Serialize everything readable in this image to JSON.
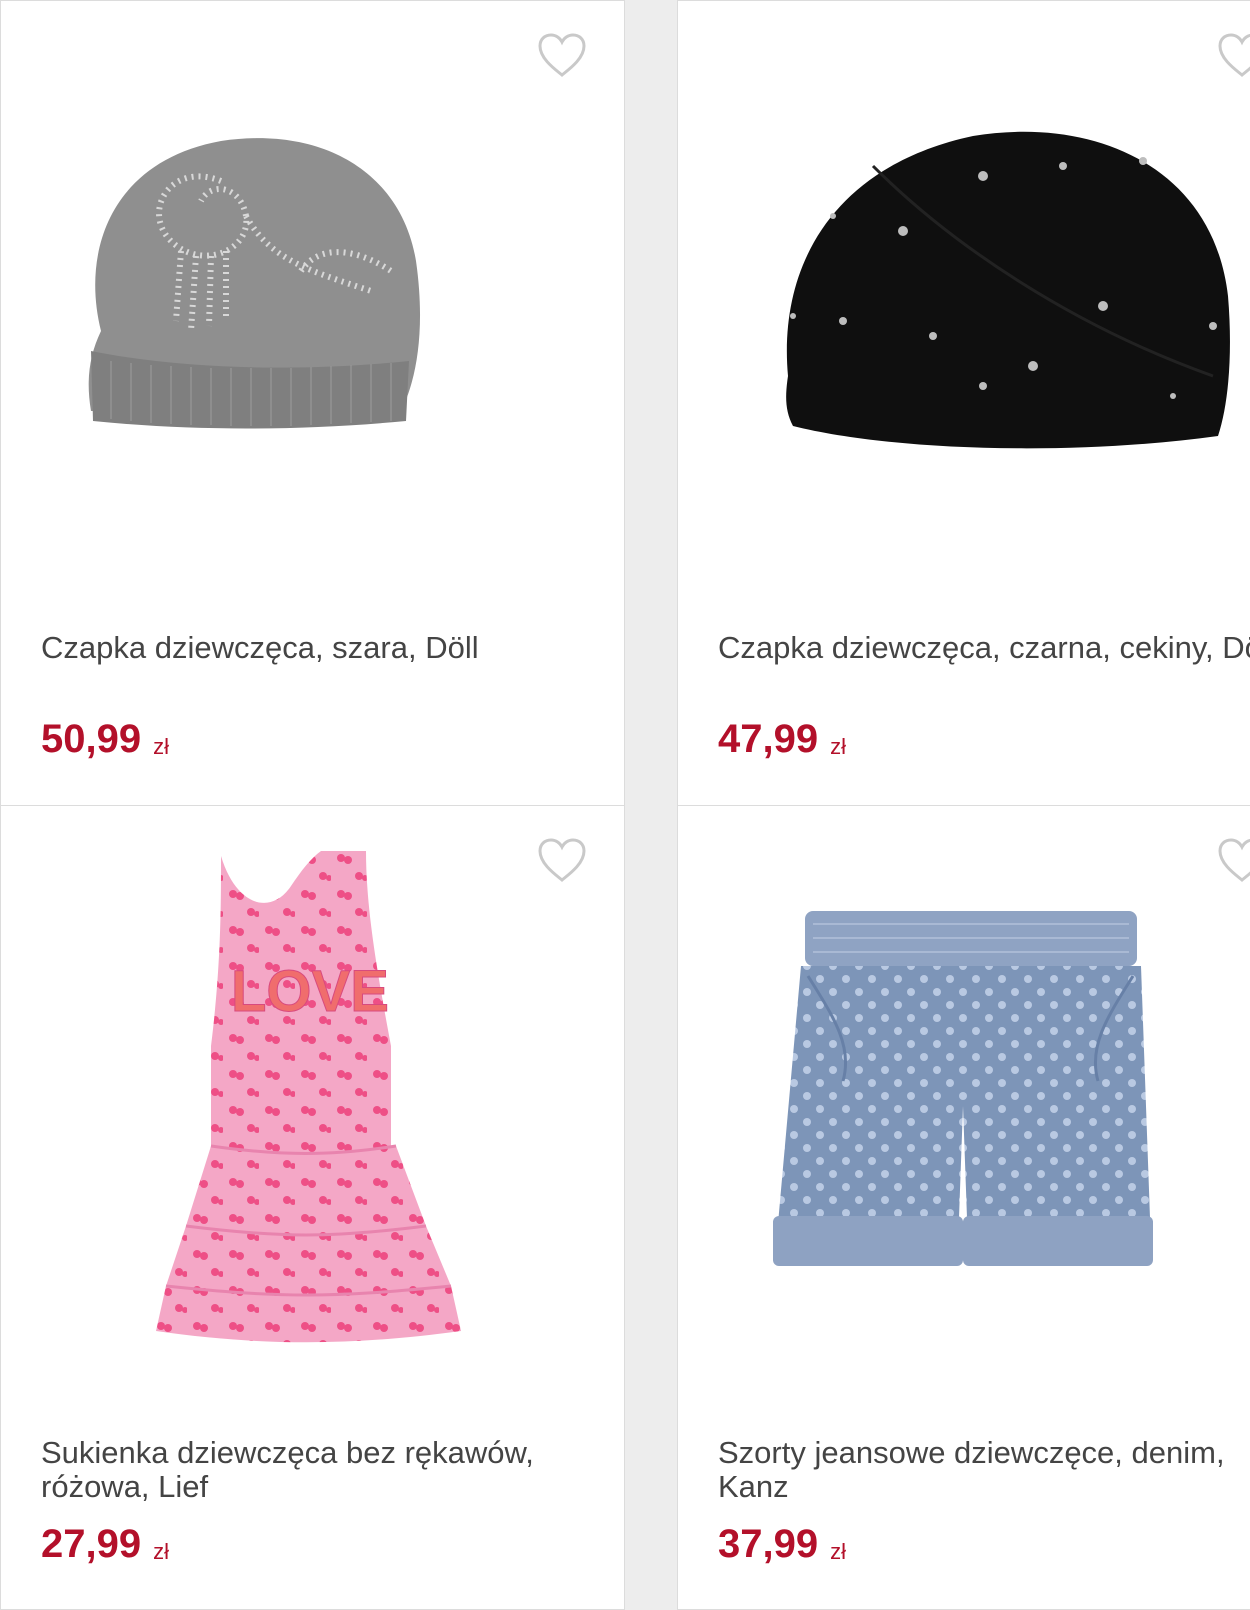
{
  "colors": {
    "price": "#b3102a",
    "title": "#444444",
    "heart": "#c9c9c9"
  },
  "currency": "zł",
  "products": [
    {
      "title": "Czapka dziewczęca, szara, Döll",
      "price": "50,99",
      "image": "grey-knit-beanie-with-rhinestones",
      "favorite_icon": "heart-outline-icon"
    },
    {
      "title": "Czapka dziewczęca, czarna, cekiny, Döll",
      "price": "47,99",
      "image": "black-knit-beanie-with-sequins",
      "favorite_icon": "heart-outline-icon"
    },
    {
      "title": "Sukienka dziewczęca bez rękawów, różowa, Lief",
      "price": "27,99",
      "image": "pink-sleeveless-dress-love",
      "favorite_icon": "heart-outline-icon"
    },
    {
      "title": "Szorty jeansowe dziewczęce, denim, Kanz",
      "price": "37,99",
      "image": "polka-dot-denim-shorts",
      "favorite_icon": "heart-outline-icon"
    }
  ]
}
